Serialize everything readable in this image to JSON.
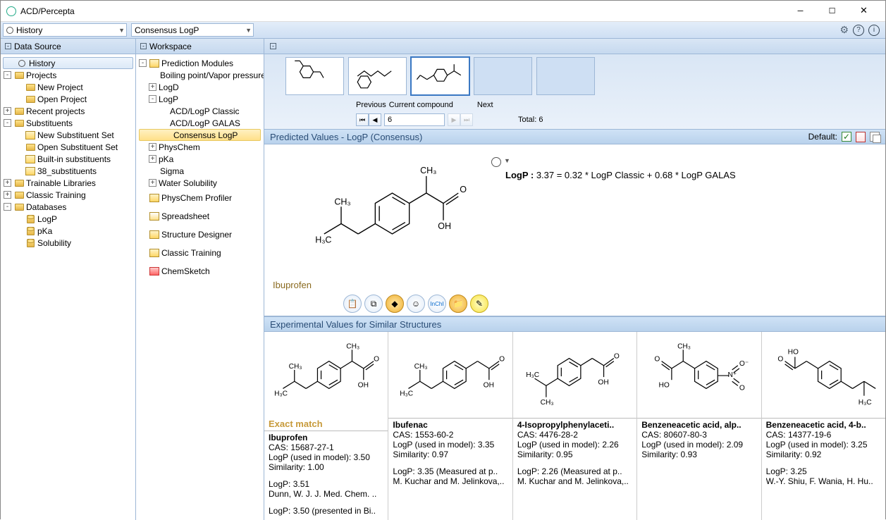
{
  "window": {
    "title": "ACD/Percepta"
  },
  "toolbar": {
    "dd1": "History",
    "dd2": "Consensus LogP"
  },
  "panels": {
    "data_source": "Data Source",
    "workspace": "Workspace"
  },
  "ds_tree": {
    "history": "History",
    "projects": "Projects",
    "new_project": "New Project",
    "open_project": "Open Project",
    "recent": "Recent projects",
    "substituents": "Substituents",
    "new_sub_set": "New Substituent Set",
    "open_sub_set": "Open Substituent Set",
    "builtin_sub": "Built-in substituents",
    "thirtyeight_sub": "38_substituents",
    "trainable": "Trainable Libraries",
    "classic_training": "Classic Training",
    "databases": "Databases",
    "db_logp": "LogP",
    "db_pka": "pKa",
    "db_sol": "Solubility"
  },
  "ws_tree": {
    "pred_modules": "Prediction Modules",
    "boiling": "Boiling point/Vapor pressure",
    "logd": "LogD",
    "logp": "LogP",
    "logp_classic": "ACD/LogP Classic",
    "logp_galas": "ACD/LogP GALAS",
    "logp_consensus": "Consensus LogP",
    "physchem": "PhysChem",
    "pka": "pKa",
    "sigma": "Sigma",
    "water_sol": "Water Solubility",
    "pc_profiler": "PhysChem Profiler",
    "spreadsheet": "Spreadsheet",
    "struct_designer": "Structure Designer",
    "classic_training": "Classic Training",
    "chemsketch": "ChemSketch"
  },
  "nav": {
    "prev": "Previous",
    "current_lbl": "Current compound",
    "next": "Next",
    "current_val": "6",
    "total_lbl": "Total: 6"
  },
  "pred": {
    "header": "Predicted Values - LogP (Consensus)",
    "default_lbl": "Default:",
    "struct_name": "Ibuprofen",
    "logp_label": "LogP :",
    "logp_formula": " 3.37 = 0.32 * LogP Classic + 0.68 * LogP GALAS"
  },
  "exp": {
    "header": "Experimental Values for Similar Structures",
    "exact_match": "Exact match",
    "items": [
      {
        "name": "Ibuprofen",
        "cas": "CAS: 15687-27-1",
        "model": "LogP (used in model): 3.50",
        "sim": "Similarity: 1.00",
        "e1": "LogP: 3.51",
        "e2": "Dunn, W. J. J. Med. Chem. ..",
        "e3": "LogP: 3.50 (presented in Bi.."
      },
      {
        "name": "Ibufenac",
        "cas": "CAS: 1553-60-2",
        "model": "LogP (used in model): 3.35",
        "sim": "Similarity: 0.97",
        "e1": "LogP: 3.35 (Measured at p..",
        "e2": "M. Kuchar and M. Jelinkova,..",
        "e3": ""
      },
      {
        "name": "4-Isopropylphenylaceti..",
        "cas": "CAS: 4476-28-2",
        "model": "LogP (used in model): 2.26",
        "sim": "Similarity: 0.95",
        "e1": "LogP: 2.26 (Measured at p..",
        "e2": "M. Kuchar and M. Jelinkova,..",
        "e3": ""
      },
      {
        "name": "Benzeneacetic acid, alp..",
        "cas": "CAS: 80607-80-3",
        "model": "LogP (used in model): 2.09",
        "sim": "Similarity: 0.93",
        "e1": "",
        "e2": "",
        "e3": ""
      },
      {
        "name": "Benzeneacetic acid, 4-b..",
        "cas": "CAS: 14377-19-6",
        "model": "LogP (used in model): 3.25",
        "sim": "Similarity: 0.92",
        "e1": "LogP: 3.25",
        "e2": "W.-Y. Shiu, F. Wania, H. Hu..",
        "e3": ""
      }
    ]
  }
}
